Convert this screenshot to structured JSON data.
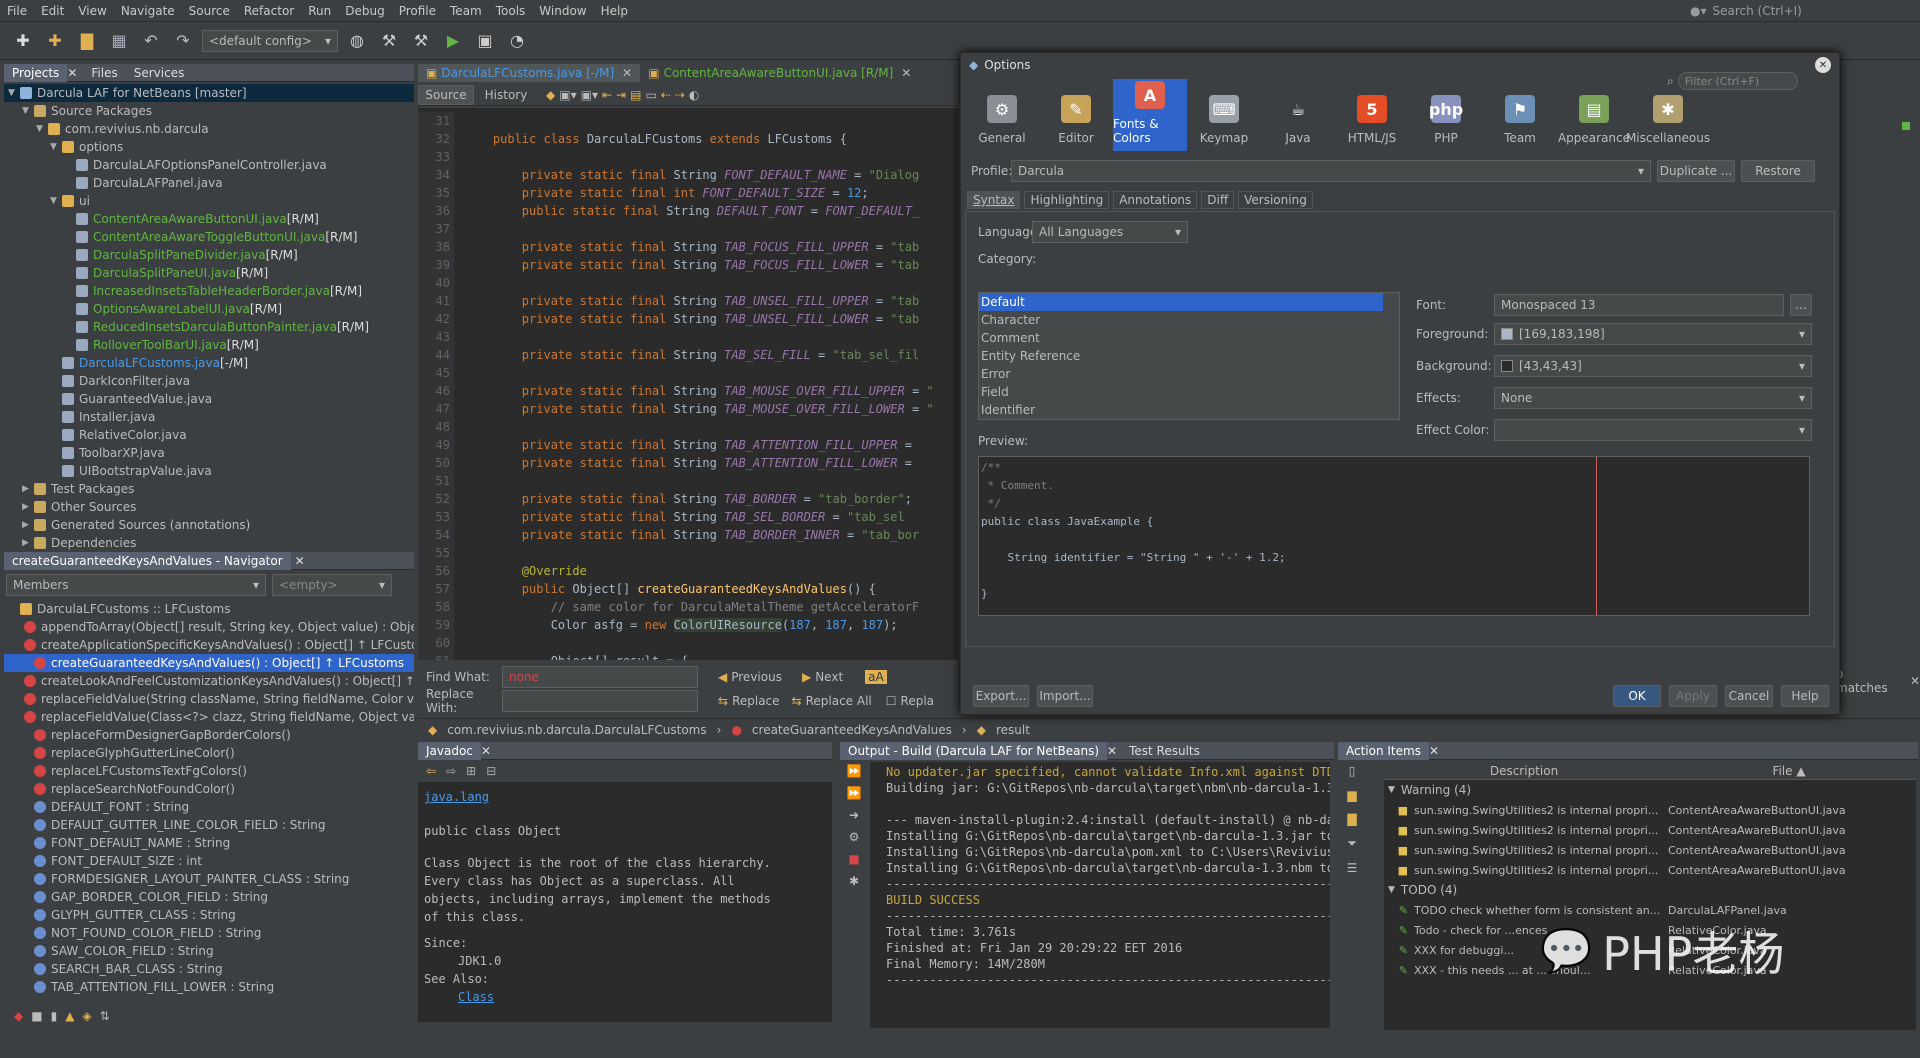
{
  "menu": [
    "File",
    "Edit",
    "View",
    "Navigate",
    "Source",
    "Refactor",
    "Run",
    "Debug",
    "Profile",
    "Team",
    "Tools",
    "Window",
    "Help"
  ],
  "search_placeholder": "Search (Ctrl+I)",
  "config": "<default config>",
  "projects": {
    "tabs": [
      "Projects",
      "Files",
      "Services"
    ],
    "rows": [
      {
        "t": "Darcula LAF for NetBeans [master]",
        "lvl": 0,
        "tri": "▼",
        "cls": "root",
        "ic": "#8fb3d9"
      },
      {
        "t": "Source Packages",
        "lvl": 1,
        "tri": "▼",
        "ic": "#c9a960"
      },
      {
        "t": "com.revivius.nb.darcula",
        "lvl": 2,
        "tri": "▼",
        "ic": "#e0b050"
      },
      {
        "t": "options",
        "lvl": 3,
        "tri": "▼",
        "ic": "#e0b050"
      },
      {
        "t": "DarculaLAFOptionsPanelController.java",
        "lvl": 4,
        "ic": "#9aa8c0"
      },
      {
        "t": "DarculaLAFPanel.java",
        "lvl": 4,
        "ic": "#9aa8c0"
      },
      {
        "t": "ui",
        "lvl": 3,
        "tri": "▼",
        "ic": "#e0b050"
      },
      {
        "t": "ContentAreaAwareButtonUI.java",
        "s": " [R/M]",
        "lvl": 4,
        "c": "g",
        "ic": "#9aa8c0"
      },
      {
        "t": "ContentAreaAwareToggleButtonUI.java",
        "s": " [R/M]",
        "lvl": 4,
        "c": "g",
        "ic": "#9aa8c0"
      },
      {
        "t": "DarculaSplitPaneDivider.java",
        "s": " [R/M]",
        "lvl": 4,
        "c": "g",
        "ic": "#9aa8c0"
      },
      {
        "t": "DarculaSplitPaneUI.java",
        "s": " [R/M]",
        "lvl": 4,
        "c": "g",
        "ic": "#9aa8c0"
      },
      {
        "t": "IncreasedInsetsTableHeaderBorder.java",
        "s": " [R/M]",
        "lvl": 4,
        "c": "g",
        "ic": "#9aa8c0"
      },
      {
        "t": "OptionsAwareLabelUI.java",
        "s": " [R/M]",
        "lvl": 4,
        "c": "g",
        "ic": "#9aa8c0"
      },
      {
        "t": "ReducedInsetsDarculaButtonPainter.java",
        "s": " [R/M]",
        "lvl": 4,
        "c": "g",
        "ic": "#9aa8c0"
      },
      {
        "t": "RolloverToolBarUI.java",
        "s": " [R/M]",
        "lvl": 4,
        "c": "g",
        "ic": "#9aa8c0"
      },
      {
        "t": "DarculaLFCustoms.java",
        "s": " [-/M]",
        "lvl": 3,
        "c": "b",
        "ic": "#9aa8c0"
      },
      {
        "t": "DarkIconFilter.java",
        "lvl": 3,
        "ic": "#9aa8c0"
      },
      {
        "t": "GuaranteedValue.java",
        "lvl": 3,
        "ic": "#9aa8c0"
      },
      {
        "t": "Installer.java",
        "lvl": 3,
        "ic": "#9aa8c0"
      },
      {
        "t": "RelativeColor.java",
        "lvl": 3,
        "ic": "#9aa8c0"
      },
      {
        "t": "ToolbarXP.java",
        "lvl": 3,
        "ic": "#9aa8c0"
      },
      {
        "t": "UIBootstrapValue.java",
        "lvl": 3,
        "ic": "#9aa8c0"
      },
      {
        "t": "Test Packages",
        "lvl": 1,
        "tri": "▶",
        "ic": "#c9a960"
      },
      {
        "t": "Other Sources",
        "lvl": 1,
        "tri": "▶",
        "ic": "#c9a960"
      },
      {
        "t": "Generated Sources (annotations)",
        "lvl": 1,
        "tri": "▶",
        "ic": "#c9a960"
      },
      {
        "t": "Dependencies",
        "lvl": 1,
        "tri": "▶",
        "ic": "#c9a960"
      }
    ]
  },
  "navigator": {
    "title": "createGuaranteedKeysAndValues - Navigator",
    "members_label": "Members",
    "empty_label": "<empty>",
    "rows": [
      {
        "t": "DarculaLFCustoms :: LFCustoms",
        "lvl": 0,
        "ic": "#e0b050"
      },
      {
        "t": "appendToArray(Object[] result, String key, Object value) : Object[]",
        "lvl": 1,
        "ic": "#d64545"
      },
      {
        "t": "createApplicationSpecificKeysAndValues() : Object[] ↑ LFCustom",
        "lvl": 1,
        "ic": "#d64545"
      },
      {
        "t": "createGuaranteedKeysAndValues() : Object[] ↑ LFCustoms",
        "lvl": 1,
        "ic": "#d64545",
        "sel": true
      },
      {
        "t": "createLookAndFeelCustomizationKeysAndValues() : Object[] ↑ L",
        "lvl": 1,
        "ic": "#d64545"
      },
      {
        "t": "replaceFieldValue(String className, String fieldName, Color va",
        "lvl": 1,
        "ic": "#d64545"
      },
      {
        "t": "replaceFieldValue(Class<?> clazz, String fieldName, Object valu",
        "lvl": 1,
        "ic": "#d64545"
      },
      {
        "t": "replaceFormDesignerGapBorderColors()",
        "lvl": 1,
        "ic": "#d64545"
      },
      {
        "t": "replaceGlyphGutterLineColor()",
        "lvl": 1,
        "ic": "#d64545"
      },
      {
        "t": "replaceLFCustomsTextFgColors()",
        "lvl": 1,
        "ic": "#d64545"
      },
      {
        "t": "replaceSearchNotFoundColor()",
        "lvl": 1,
        "ic": "#d64545"
      },
      {
        "t": "DEFAULT_FONT : String",
        "lvl": 1,
        "ic": "#6a8fd0"
      },
      {
        "t": "DEFAULT_GUTTER_LINE_COLOR_FIELD : String",
        "lvl": 1,
        "ic": "#6a8fd0"
      },
      {
        "t": "FONT_DEFAULT_NAME : String",
        "lvl": 1,
        "ic": "#6a8fd0"
      },
      {
        "t": "FONT_DEFAULT_SIZE : int",
        "lvl": 1,
        "ic": "#6a8fd0"
      },
      {
        "t": "FORMDESIGNER_LAYOUT_PAINTER_CLASS : String",
        "lvl": 1,
        "ic": "#6a8fd0"
      },
      {
        "t": "GAP_BORDER_COLOR_FIELD : String",
        "lvl": 1,
        "ic": "#6a8fd0"
      },
      {
        "t": "GLYPH_GUTTER_CLASS : String",
        "lvl": 1,
        "ic": "#6a8fd0"
      },
      {
        "t": "NOT_FOUND_COLOR_FIELD : String",
        "lvl": 1,
        "ic": "#6a8fd0"
      },
      {
        "t": "SAW_COLOR_FIELD : String",
        "lvl": 1,
        "ic": "#6a8fd0"
      },
      {
        "t": "SEARCH_BAR_CLASS : String",
        "lvl": 1,
        "ic": "#6a8fd0"
      },
      {
        "t": "TAB_ATTENTION_FILL_LOWER : String",
        "lvl": 1,
        "ic": "#6a8fd0"
      }
    ]
  },
  "editor": {
    "tabs": [
      {
        "t": "DarculaLFCustoms.java [-/M]",
        "c": "b",
        "act": true
      },
      {
        "t": "ContentAreaAwareButtonUI.java [R/M]",
        "c": "g"
      }
    ],
    "subtabs": [
      "Source",
      "History"
    ],
    "lines": [
      {
        "n": "31",
        "h": ""
      },
      {
        "n": "32",
        "h": "    <span class=kw>public class</span> DarculaLFCustoms <span class=kw>extends</span> LFCustoms {"
      },
      {
        "n": "33",
        "h": ""
      },
      {
        "n": "34",
        "h": "        <span class=kw>private static final</span> String <span class=fld>FONT_DEFAULT_NAME</span> = <span class=str>\"Dialog</span>"
      },
      {
        "n": "35",
        "h": "        <span class=kw>private static final int</span> <span class=fld>FONT_DEFAULT_SIZE</span> = <span class=b>12</span>;"
      },
      {
        "n": "36",
        "h": "        <span class=kw>public static final</span> String <span class=fld>DEFAULT_FONT</span> = <span class=fld>FONT_DEFAULT_</span>"
      },
      {
        "n": "37",
        "h": ""
      },
      {
        "n": "38",
        "h": "        <span class=kw>private static final</span> String <span class=fld>TAB_FOCUS_FILL_UPPER</span> = <span class=str>\"tab</span>"
      },
      {
        "n": "39",
        "h": "        <span class=kw>private static final</span> String <span class=fld>TAB_FOCUS_FILL_LOWER</span> = <span class=str>\"tab</span>"
      },
      {
        "n": "40",
        "h": ""
      },
      {
        "n": "41",
        "h": "        <span class=kw>private static final</span> String <span class=fld>TAB_UNSEL_FILL_UPPER</span> = <span class=str>\"tab</span>"
      },
      {
        "n": "42",
        "h": "        <span class=kw>private static final</span> String <span class=fld>TAB_UNSEL_FILL_LOWER</span> = <span class=str>\"tab</span>"
      },
      {
        "n": "43",
        "h": ""
      },
      {
        "n": "44",
        "h": "        <span class=kw>private static final</span> String <span class=fld>TAB_SEL_FILL</span> = <span class=str>\"tab_sel_fil</span>"
      },
      {
        "n": "45",
        "h": ""
      },
      {
        "n": "46",
        "h": "        <span class=kw>private static final</span> String <span class=fld>TAB_MOUSE_OVER_FILL_UPPER</span> = <span class=str>\"</span>"
      },
      {
        "n": "47",
        "h": "        <span class=kw>private static final</span> String <span class=fld>TAB_MOUSE_OVER_FILL_LOWER</span> = <span class=str>\"</span>"
      },
      {
        "n": "48",
        "h": ""
      },
      {
        "n": "49",
        "h": "        <span class=kw>private static final</span> String <span class=fld>TAB_ATTENTION_FILL_UPPER</span> ="
      },
      {
        "n": "50",
        "h": "        <span class=kw>private static final</span> String <span class=fld>TAB_ATTENTION_FILL_LOWER</span> ="
      },
      {
        "n": "51",
        "h": ""
      },
      {
        "n": "52",
        "h": "        <span class=kw>private static final</span> String <span class=fld>TAB_BORDER</span> = <span class=str>\"tab_border\"</span>;"
      },
      {
        "n": "53",
        "h": "        <span class=kw>private static final</span> String <span class=fld>TAB_SEL_BORDER</span> = <span class=str>\"tab_sel</span>"
      },
      {
        "n": "54",
        "h": "        <span class=kw>private static final</span> String <span class=fld>TAB_BORDER_INNER</span> = <span class=str>\"tab_bor</span>"
      },
      {
        "n": "55",
        "h": ""
      },
      {
        "n": "56",
        "h": "        <span class=ann>@Override</span>"
      },
      {
        "n": "57",
        "h": "        <span class=kw>public</span> Object[] <span class=fn>createGuaranteedKeysAndValues</span>() {"
      },
      {
        "n": "58",
        "h": "            <span class=cm>// same color for DarculaMetalTheme getAcceleratorF</span>"
      },
      {
        "n": "59",
        "h": "            Color asfg = <span class=kw>new</span> <span style='background:#344134'>ColorUIResource</span>(<span class=b>187</span>, <span class=b>187</span>, <span class=b>187</span>);"
      },
      {
        "n": "60",
        "h": ""
      },
      {
        "n": "61",
        "h": "            Object[] result = {"
      }
    ]
  },
  "find": {
    "what_label": "Find What:",
    "what_value": "none",
    "replace_label": "Replace With:",
    "previous": "Previous",
    "next": "Next",
    "replace": "Replace",
    "replace_all": "Replace All",
    "repla": "Repla",
    "matches": "o matches"
  },
  "breadcrumb": [
    "com.revivius.nb.darcula.DarculaLFCustoms",
    "createGuaranteedKeysAndValues",
    "result"
  ],
  "javadoc": {
    "title": "Javadoc",
    "pkg": "java.lang",
    "decl": "public class Object",
    "body": "Class Object is the root of the class hierarchy.\nEvery class has Object as a superclass. All\nobjects, including arrays, implement the methods\nof this class.",
    "since_label": "Since:",
    "since": "JDK1.0",
    "see_label": "See Also:",
    "see": "Class"
  },
  "output": {
    "tabs": [
      "Output - Build (Darcula LAF for NetBeans)",
      "Test Results"
    ],
    "lines": [
      {
        "t": "No updater.jar specified, cannot validate Info.xml against DTD",
        "c": "#c5a73b"
      },
      {
        "t": "Building jar: G:\\GitRepos\\nb-darcula\\target\\nbm\\nb-darcula-1.3",
        "c": "#bbb"
      },
      {
        "t": "",
        "c": "#bbb"
      },
      {
        "t": "--- maven-install-plugin:2.4:install (default-install) @ nb-da",
        "c": "#bbb"
      },
      {
        "t": "Installing G:\\GitRepos\\nb-darcula\\target\\nb-darcula-1.3.jar to",
        "c": "#bbb"
      },
      {
        "t": "Installing G:\\GitRepos\\nb-darcula\\pom.xml to C:\\Users\\Revivius",
        "c": "#bbb"
      },
      {
        "t": "Installing G:\\GitRepos\\nb-darcula\\target\\nb-darcula-1.3.nbm to",
        "c": "#bbb"
      },
      {
        "t": "------------------------------------------------------------------------",
        "c": "#bbb"
      },
      {
        "t": "BUILD SUCCESS",
        "c": "#c5a73b"
      },
      {
        "t": "------------------------------------------------------------------------",
        "c": "#bbb"
      },
      {
        "t": "Total time: 3.761s",
        "c": "#bbb"
      },
      {
        "t": "Finished at: Fri Jan 29 20:29:22 EET 2016",
        "c": "#bbb"
      },
      {
        "t": "Final Memory: 14M/280M",
        "c": "#bbb"
      },
      {
        "t": "------------------------------------------------------------------------",
        "c": "#bbb"
      }
    ]
  },
  "actions": {
    "title": "Action Items",
    "col_desc": "Description",
    "col_file": "File ▲",
    "groups": [
      {
        "name": "Warning (4)",
        "items": [
          {
            "d": "sun.swing.SwingUtilities2 is internal propri...",
            "f": "ContentAreaAwareButtonUI.java"
          },
          {
            "d": "sun.swing.SwingUtilities2 is internal propri...",
            "f": "ContentAreaAwareButtonUI.java"
          },
          {
            "d": "sun.swing.SwingUtilities2 is internal propri...",
            "f": "ContentAreaAwareButtonUI.java"
          },
          {
            "d": "sun.swing.SwingUtilities2 is internal propri...",
            "f": "ContentAreaAwareButtonUI.java"
          }
        ]
      },
      {
        "name": "TODO (4)",
        "items": [
          {
            "d": "TODO check whether form is consistent an...",
            "f": "DarculaLAFPanel.java"
          },
          {
            "d": "Todo - check for ...ences",
            "f": "RelativeColor.java"
          },
          {
            "d": "XXX for debuggi...",
            "f": "RelativeColor.java"
          },
          {
            "d": "XXX - this needs ... at ... shoul...",
            "f": "RelativeColor.java"
          }
        ]
      }
    ]
  },
  "watermark": "PHP老杨",
  "options": {
    "title": "Options",
    "filter_placeholder": "Filter (Ctrl+F)",
    "categories": [
      {
        "label": "General",
        "icon": "general-icon",
        "color": "#8a8f96",
        "glyph": "⚙"
      },
      {
        "label": "Editor",
        "icon": "editor-icon",
        "color": "#c7a35a",
        "glyph": "✎"
      },
      {
        "label": "Fonts & Colors",
        "icon": "fonts-colors-icon",
        "color": "#e06050",
        "glyph": "A",
        "sel": true
      },
      {
        "label": "Keymap",
        "icon": "keymap-icon",
        "color": "#9aa0a8",
        "glyph": "⌨"
      },
      {
        "label": "Java",
        "icon": "java-icon",
        "color": "#3c3f41",
        "glyph": "☕"
      },
      {
        "label": "HTML/JS",
        "icon": "html5-icon",
        "color": "#e44d26",
        "glyph": "5"
      },
      {
        "label": "PHP",
        "icon": "php-icon",
        "color": "#8892bf",
        "glyph": "php"
      },
      {
        "label": "Team",
        "icon": "team-icon",
        "color": "#6b8fb5",
        "glyph": "⚑"
      },
      {
        "label": "Appearance",
        "icon": "appearance-icon",
        "color": "#7aa05a",
        "glyph": "▤"
      },
      {
        "label": "Miscellaneous",
        "icon": "misc-icon",
        "color": "#b0a070",
        "glyph": "✱"
      }
    ],
    "profile_label": "Profile:",
    "profile_value": "Darcula",
    "duplicate": "Duplicate ...",
    "restore": "Restore",
    "subtabs": [
      "Syntax",
      "Highlighting",
      "Annotations",
      "Diff",
      "Versioning"
    ],
    "language_label": "Language:",
    "language_value": "All Languages",
    "category_label": "Category:",
    "category_items": [
      "Default",
      "Character",
      "Comment",
      "Entity Reference",
      "Error",
      "Field",
      "Identifier"
    ],
    "font_label": "Font:",
    "font_value": "Monospaced 13",
    "fg_label": "Foreground:",
    "fg_value": "[169,183,198]",
    "fg_color": "#a9b7c6",
    "bg_label": "Background:",
    "bg_value": "[43,43,43]",
    "bg_color": "#2b2b2b",
    "effects_label": "Effects:",
    "effects_value": "None",
    "effect_color_label": "Effect Color:",
    "preview_label": "Preview:",
    "preview_lines": [
      "/**",
      " * Comment.",
      " */",
      "public class JavaExample {",
      "",
      "    String identifier = \"String \" + '-' + 1.2;",
      "",
      "}"
    ],
    "export": "Export...",
    "import": "Import...",
    "ok": "OK",
    "apply": "Apply",
    "cancel": "Cancel",
    "help": "Help"
  }
}
